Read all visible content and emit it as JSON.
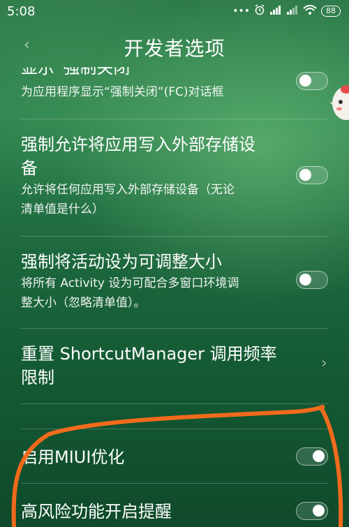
{
  "status": {
    "time": "5:08",
    "icons": [
      "dots-icon",
      "alarm-icon",
      "signal-icon",
      "signal-icon",
      "wifi-icon"
    ],
    "battery": "88"
  },
  "header": {
    "title": "开发者选项"
  },
  "items": [
    {
      "title": "显示“强制关闭”",
      "subtitle": "为应用程序显示“强制关闭”(FC)对话框",
      "toggle": "off"
    },
    {
      "title_line1": "强制允许将应用写入外部存储设",
      "title_line2": "备",
      "subtitle_line1": "允许将任何应用写入外部存储设备（无论",
      "subtitle_line2": "清单值是什么）",
      "toggle": "off"
    },
    {
      "title": "强制将活动设为可调整大小",
      "subtitle_line1": "将所有 Activity 设为可配合多窗口环境调",
      "subtitle_line2": "整大小（忽略清单值）。",
      "toggle": "off"
    },
    {
      "title_line1": "重置 ShortcutManager 调用频率",
      "title_line2": "限制"
    },
    {
      "title": "启用MIUI优化",
      "toggle": "on"
    },
    {
      "title": "高风险功能开启提醒",
      "toggle": "on"
    }
  ],
  "colors": {
    "annotation": "#f26a1b"
  }
}
